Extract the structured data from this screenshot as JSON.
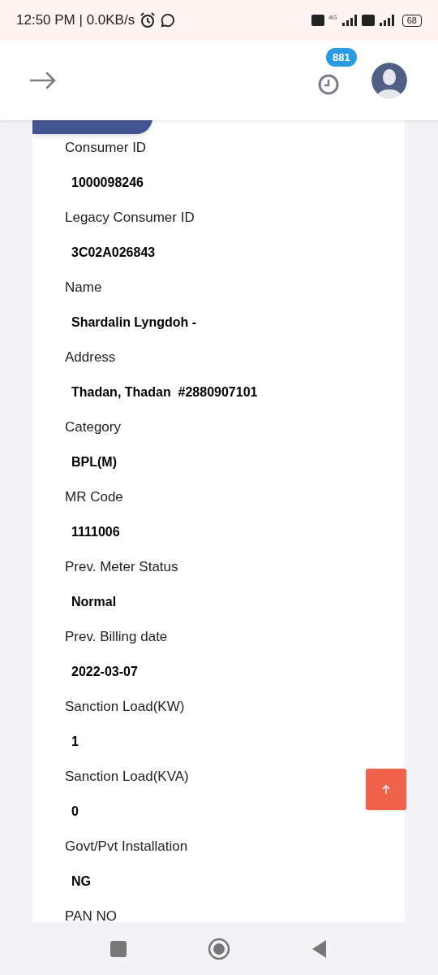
{
  "status_bar": {
    "time": "12:50 PM | 0.0KB/s",
    "battery": "68",
    "network": "4G"
  },
  "header": {
    "notification_count": "881"
  },
  "fields": [
    {
      "label": "Consumer ID",
      "value": "1000098246"
    },
    {
      "label": "Legacy Consumer ID",
      "value": "3C02A026843"
    },
    {
      "label": "Name",
      "value": "Shardalin Lyngdoh -"
    },
    {
      "label": "Address",
      "value": "Thadan, Thadan  #2880907101"
    },
    {
      "label": "Category",
      "value": "BPL(M)"
    },
    {
      "label": "MR Code",
      "value": "1111006"
    },
    {
      "label": "Prev. Meter Status",
      "value": "Normal"
    },
    {
      "label": "Prev. Billing date",
      "value": "2022-03-07"
    },
    {
      "label": "Sanction Load(KW)",
      "value": "1"
    },
    {
      "label": "Sanction Load(KVA)",
      "value": "0"
    },
    {
      "label": "Govt/Pvt Installation",
      "value": "NG"
    },
    {
      "label": "PAN NO"
    }
  ]
}
